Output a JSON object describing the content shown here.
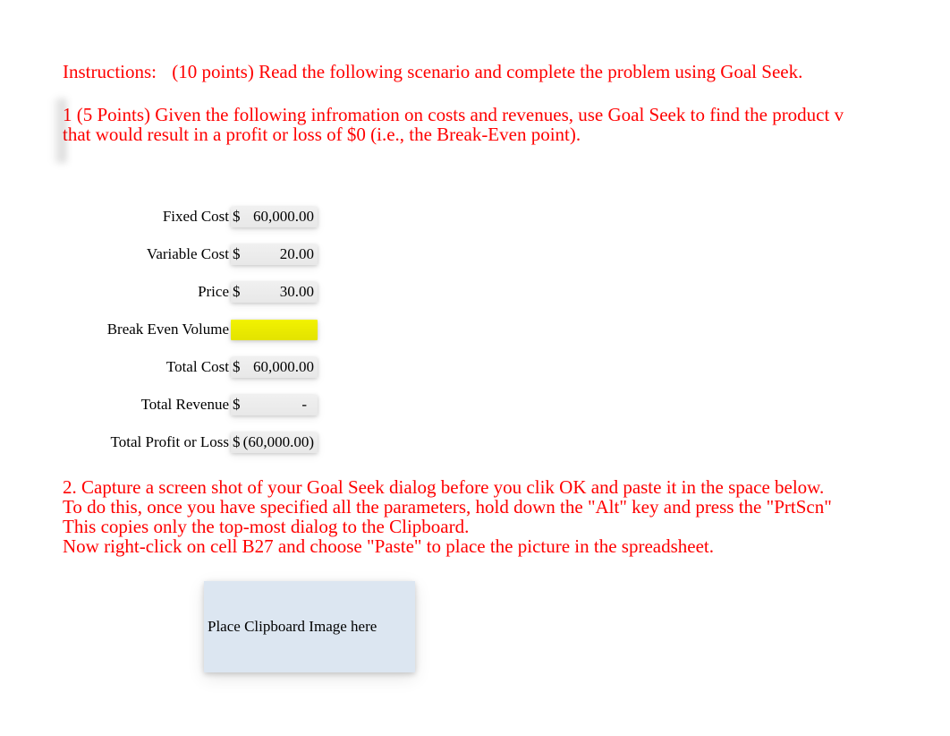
{
  "instructions_label": "Instructions:",
  "instructions_text": "(10 points) Read the following scenario and complete the problem using Goal Seek.",
  "q1_line1": "1 (5 Points) Given the following infromation on costs and revenues, use Goal Seek to find the product v",
  "q1_line2": "that would result in a profit or loss of $0 (i.e., the Break-Even point).",
  "rows": {
    "fixed_cost": {
      "label": "Fixed Cost",
      "currency": "$",
      "value": "60,000.00"
    },
    "variable_cost": {
      "label": "Variable Cost",
      "currency": "$",
      "value": "20.00"
    },
    "price": {
      "label": "Price",
      "currency": "$",
      "value": "30.00"
    },
    "break_even": {
      "label": "Break Even Volume",
      "currency": "",
      "value": ""
    },
    "total_cost": {
      "label": "Total Cost",
      "currency": "$",
      "value": "60,000.00"
    },
    "total_revenue": {
      "label": "Total Revenue",
      "currency": "$",
      "value": "-"
    },
    "total_profit": {
      "label": "Total Profit or Loss",
      "currency": "$",
      "value": "(60,000.00)"
    }
  },
  "q2_line1": "2.  Capture a screen shot of your Goal Seek dialog before you clik OK and paste it in the space below.",
  "q2_line2": "To do this, once you have specified all the parameters, hold down the \"Alt\" key and press the \"PrtScn\"",
  "q2_line3": "This copies only the top-most dialog to the Clipboard.",
  "q2_line4": "Now right-click on cell B27 and choose \"Paste\" to place the picture in the spreadsheet.",
  "placeholder_text": "Place Clipboard Image here"
}
